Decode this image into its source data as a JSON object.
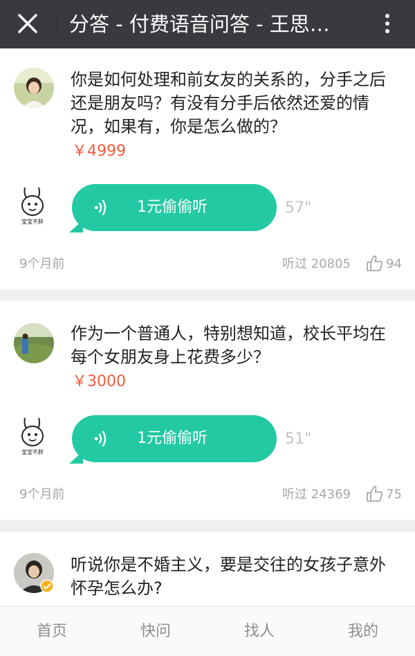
{
  "topbar": {
    "title": "分答 - 付费语音问答 - 王思…"
  },
  "items": [
    {
      "question": "你是如何处理和前女友的关系的，分手之后还是朋友吗？有没有分手后依然还爱的情况，如果有，你是怎么做的？",
      "price": "￥4999",
      "answerer_caption": "宝宝不胖",
      "listen_label": "1元偷偷听",
      "duration": "57\"",
      "time_ago": "9个月前",
      "listened": "听过 20805",
      "likes": "94"
    },
    {
      "question": "作为一个普通人，特别想知道，校长平均在每个女朋友身上花费多少？",
      "price": "￥3000",
      "answerer_caption": "宝宝不胖",
      "listen_label": "1元偷偷听",
      "duration": "51\"",
      "time_ago": "9个月前",
      "listened": "听过 24369",
      "likes": "75"
    },
    {
      "question": "听说你是不婚主义，要是交往的女孩子意外怀孕怎么办?"
    }
  ],
  "nav": {
    "home": "首页",
    "quick_ask": "快问",
    "find": "找人",
    "mine": "我的"
  },
  "colors": {
    "topbar": "#393a3f",
    "accent": "#23c9a2",
    "price": "#f25a3c"
  }
}
